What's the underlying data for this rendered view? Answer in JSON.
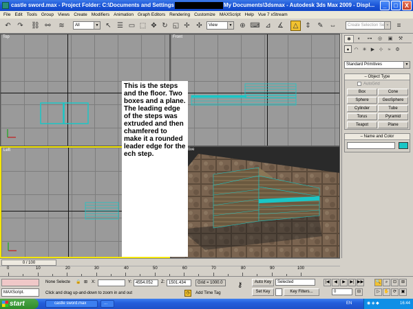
{
  "window": {
    "title_before": "castle sword.max  - Project Folder: C:\\Documents and Settings",
    "title_after": "My Documents\\3dsmax   - Autodesk 3ds Max  2009    - Displ...",
    "buttons": [
      "_",
      "□",
      "X"
    ]
  },
  "menu": [
    "File",
    "Edit",
    "Tools",
    "Group",
    "Views",
    "Create",
    "Modifiers",
    "Animation",
    "Graph Editors",
    "Rendering",
    "Customize",
    "MAXScript",
    "Help",
    "Vue 7 xStream"
  ],
  "toolbar": {
    "filter_value": "All",
    "refcoord_value": "View",
    "named_selection_placeholder": "Create Selection Set"
  },
  "viewports": {
    "top": "Top",
    "front": "Front",
    "left": "Left",
    "perspective": "Perspective"
  },
  "note": "This is the steps and the floor. Two boxes and a plane.  The leading edge of the steps was extruded and then chamfered to make it a rounded leader edge for the ech step.",
  "command_panel": {
    "category": "Standard Primitives",
    "object_type_title": "Object Type",
    "autogrid": "AutoGrid",
    "objects": [
      "Box",
      "Cone",
      "Sphere",
      "GeoSphere",
      "Cylinder",
      "Tube",
      "Torus",
      "Pyramid",
      "Teapot",
      "Plane"
    ],
    "name_color_title": "Name and Color",
    "object_color": "#1ac6c6"
  },
  "timeline": {
    "frame_display": "0 / 100",
    "ticks": [
      "0",
      "10",
      "20",
      "30",
      "40",
      "50",
      "60",
      "70",
      "80",
      "90",
      "100"
    ]
  },
  "status": {
    "maxscript": "MAXScript.",
    "selection": "None Selecte",
    "x_label": "X:",
    "x_value": "",
    "y_label": "Y:",
    "y_value": "4554.052",
    "z_label": "Z:",
    "z_value": "1501.434",
    "grid": "Grid = 1000.0",
    "prompt": "Click and drag up-and-down to zoom in and out",
    "add_time_tag": "Add Time Tag",
    "auto_key": "Auto Key",
    "set_key": "Set Key",
    "key_mode": "Selected",
    "key_filters": "Key Filters...",
    "frame": "0"
  },
  "taskbar": {
    "start": "start",
    "task": "castle sword.max",
    "more": "...",
    "lang": "EN",
    "time": "16:44"
  }
}
